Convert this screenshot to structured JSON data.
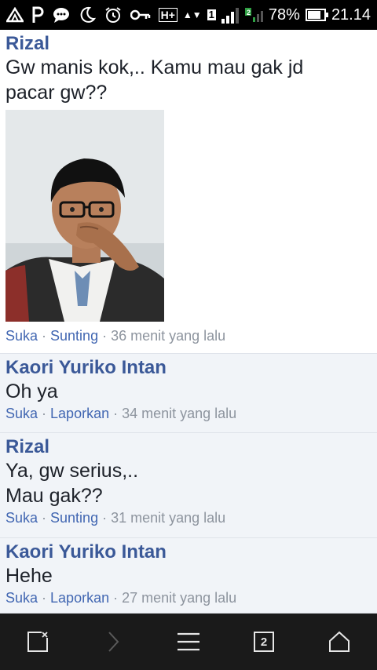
{
  "status_bar": {
    "left_icons": [
      "warning-triangle-icon",
      "p-app-icon",
      "chat-bubble-icon",
      "moon-icon",
      "alarm-icon",
      "key-icon"
    ],
    "network": "H+",
    "sim_label": "1",
    "signal_level": 0.75,
    "battery_percent": "78%",
    "battery_level": 0.78,
    "time": "21.14"
  },
  "comments": [
    {
      "author": "Rizal",
      "lines": [
        "Gw manis kok,.. Kamu mau gak jd",
        "pacar gw??"
      ],
      "has_photo": true,
      "action1": "Suka",
      "action2": "Sunting",
      "time": "36 menit yang lalu"
    },
    {
      "author": "Kaori Yuriko Intan",
      "lines": [
        "Oh ya"
      ],
      "action1": "Suka",
      "action2": "Laporkan",
      "time": "34 menit yang lalu"
    },
    {
      "author": "Rizal",
      "lines": [
        "Ya, gw serius,..",
        "Mau gak??"
      ],
      "action1": "Suka",
      "action2": "Sunting",
      "time": "31 menit yang lalu"
    },
    {
      "author": "Kaori Yuriko Intan",
      "lines": [
        "Hehe"
      ],
      "action1": "Suka",
      "action2": "Laporkan",
      "time": "27 menit yang lalu"
    }
  ],
  "separator": " · ",
  "navbar": {
    "tab_count": "2",
    "icons": [
      "close-tab-icon",
      "forward-arrow-icon",
      "menu-icon",
      "tabs-icon",
      "home-icon"
    ]
  },
  "colors": {
    "author": "#3b5998",
    "meta": "#8d949e",
    "action": "#4267b2",
    "alt_bg": "#f1f4f8"
  }
}
